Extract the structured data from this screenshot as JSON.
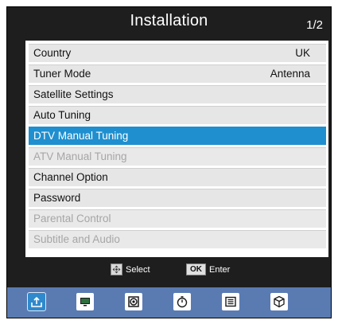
{
  "header": {
    "title": "Installation",
    "page": "1/2"
  },
  "menu": {
    "items": [
      {
        "label": "Country",
        "value": "UK",
        "state": "normal"
      },
      {
        "label": "Tuner Mode",
        "value": "Antenna",
        "state": "normal"
      },
      {
        "label": "Satellite Settings",
        "value": "",
        "state": "normal"
      },
      {
        "label": "Auto Tuning",
        "value": "",
        "state": "normal"
      },
      {
        "label": "DTV Manual Tuning",
        "value": "",
        "state": "selected"
      },
      {
        "label": "ATV Manual Tuning",
        "value": "",
        "state": "disabled"
      },
      {
        "label": "Channel Option",
        "value": "",
        "state": "normal"
      },
      {
        "label": "Password",
        "value": "",
        "state": "normal"
      },
      {
        "label": "Parental Control",
        "value": "",
        "state": "disabled"
      },
      {
        "label": "Subtitle and Audio",
        "value": "",
        "state": "disabled"
      }
    ]
  },
  "hints": {
    "select_label": "Select",
    "ok_key": "OK",
    "enter_label": "Enter"
  },
  "tabs": [
    {
      "icon": "installation-icon",
      "active": true
    },
    {
      "icon": "picture-icon",
      "active": false
    },
    {
      "icon": "sound-icon",
      "active": false
    },
    {
      "icon": "timer-icon",
      "active": false
    },
    {
      "icon": "options-icon",
      "active": false
    },
    {
      "icon": "lock-icon",
      "active": false
    }
  ],
  "colors": {
    "background": "#1e1e1e",
    "selected": "#1f8fcf",
    "disabled_text": "#a6a6a6",
    "bottom_bar": "#5a7bb2"
  }
}
